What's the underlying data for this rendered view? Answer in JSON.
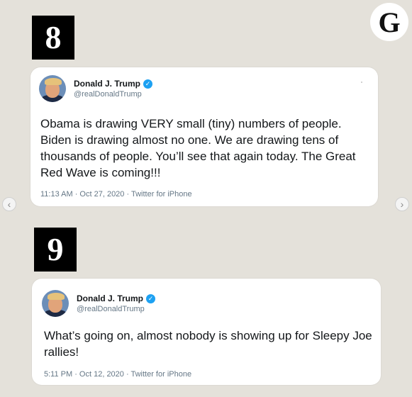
{
  "labels": {
    "number_8": "8",
    "number_9": "9"
  },
  "brand": {
    "logo_letter": "G"
  },
  "colors": {
    "background": "#e4e1da",
    "verified_badge": "#1da1f2",
    "secondary_text": "#657786"
  },
  "carousel": {
    "prev_glyph": "‹",
    "next_glyph": "›"
  },
  "tweets": [
    {
      "display_name": "Donald J. Trump",
      "handle": "@realDonaldTrump",
      "verified_glyph": "✓",
      "text": "Obama is drawing VERY small (tiny) numbers of people. Biden is drawing almost no one. We are drawing tens of thousands of people. You’ll see that again today. The Great Red Wave is coming!!!",
      "meta": "11:13 AM · Oct 27, 2020 · Twitter for iPhone"
    },
    {
      "display_name": "Donald J. Trump",
      "handle": "@realDonaldTrump",
      "verified_glyph": "✓",
      "text": "What’s going on, almost nobody is showing up for Sleepy Joe rallies!",
      "meta": "5:11 PM · Oct 12, 2020 · Twitter for iPhone"
    }
  ]
}
